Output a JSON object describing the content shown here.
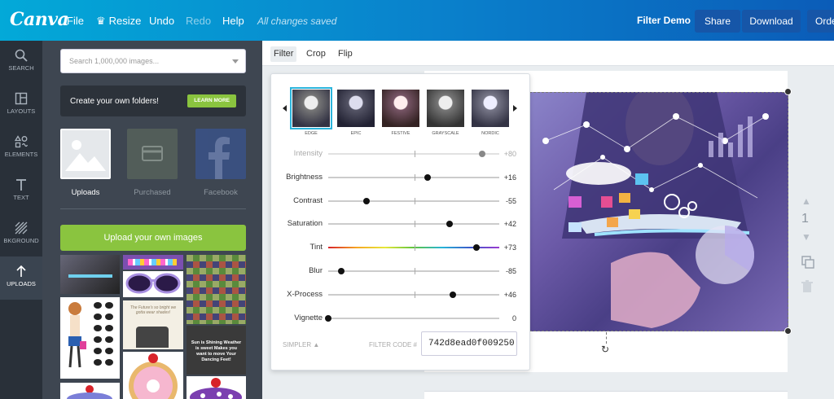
{
  "topbar": {
    "logo": "Canva",
    "file": "File",
    "resize": "Resize",
    "undo": "Undo",
    "redo": "Redo",
    "help": "Help",
    "status": "All changes saved",
    "document_title": "Filter Demo",
    "share": "Share",
    "download": "Download",
    "order": "Orde"
  },
  "nav": [
    {
      "label": "SEARCH",
      "icon": "search-icon"
    },
    {
      "label": "LAYOUTS",
      "icon": "layouts-icon"
    },
    {
      "label": "ELEMENTS",
      "icon": "elements-icon"
    },
    {
      "label": "TEXT",
      "icon": "text-icon"
    },
    {
      "label": "BKGROUND",
      "icon": "background-icon"
    },
    {
      "label": "UPLOADS",
      "icon": "upload-icon"
    }
  ],
  "panel": {
    "search_placeholder": "Search 1,000,000 images...",
    "folders_text": "Create your own folders!",
    "learn_more": "LEARN MORE",
    "tabs": [
      "Uploads",
      "Purchased",
      "Facebook"
    ],
    "upload_button": "Upload your own images",
    "thumb_texts": {
      "quote": "The Future's so bright we gotta wear shades!",
      "sunshine": "Sun is Shining Weather is sweet Makes you want to move Your Dancing Feet!"
    }
  },
  "toolbar": {
    "items": [
      "Filter",
      "Crop",
      "Flip"
    ],
    "active": "Filter"
  },
  "filter": {
    "presets": [
      "EDGE",
      "EPIC",
      "FESTIVE",
      "GRAYSCALE",
      "NORDIC"
    ],
    "active_preset": "EDGE",
    "sliders": [
      {
        "label": "Intensity",
        "value": 80,
        "display": "+80",
        "muted": true
      },
      {
        "label": "Brightness",
        "value": 16,
        "display": "+16"
      },
      {
        "label": "Contrast",
        "value": -55,
        "display": "-55"
      },
      {
        "label": "Saturation",
        "value": 42,
        "display": "+42"
      },
      {
        "label": "Tint",
        "value": 73,
        "display": "+73",
        "rainbow": true
      },
      {
        "label": "Blur",
        "value": -85,
        "display": "-85"
      },
      {
        "label": "X-Process",
        "value": 46,
        "display": "+46"
      },
      {
        "label": "Vignette",
        "value": 0,
        "display": "0",
        "min_zero": true
      }
    ],
    "simpler": "SIMPLER",
    "filter_code_label": "FILTER CODE #",
    "filter_code": "742d8ead0f009250"
  },
  "canvas": {
    "page_number": "1"
  },
  "colors": {
    "accent_green": "#8ac43f",
    "topbar_blue": "#0a7fcb",
    "selected": "#2bb4dc"
  }
}
